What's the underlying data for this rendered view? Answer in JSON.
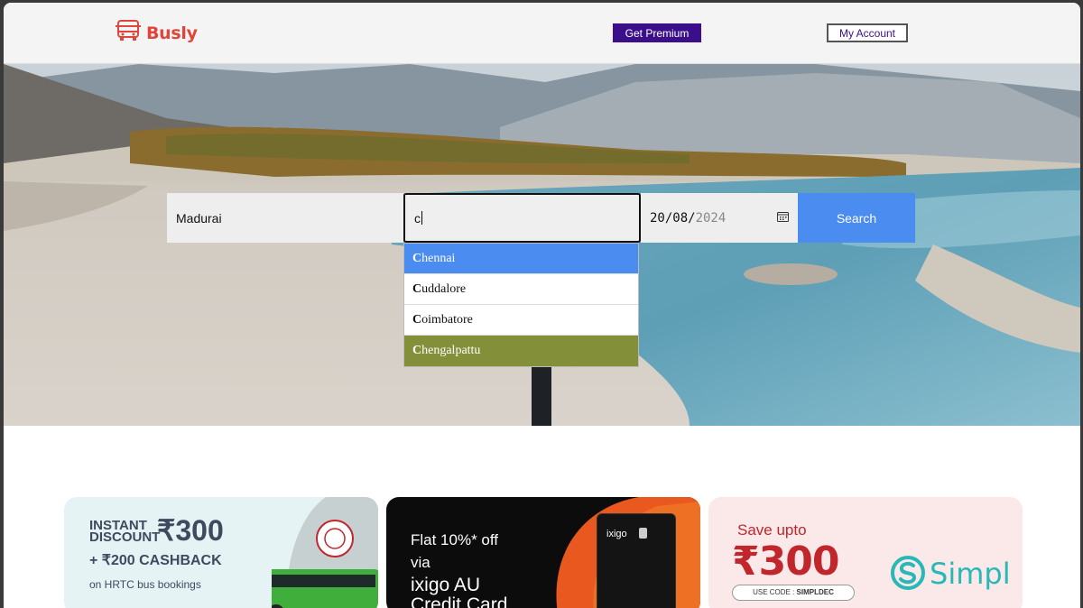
{
  "header": {
    "brand": "Busly",
    "premium_label": "Get Premium",
    "account_label": "My Account"
  },
  "search": {
    "from_value": "Madurai",
    "to_value": "c",
    "date_day_month": "20/08/",
    "date_year": "2024",
    "search_label": "Search"
  },
  "suggestions": [
    {
      "match": "C",
      "rest": "hennai"
    },
    {
      "match": "C",
      "rest": "uddalore"
    },
    {
      "match": "C",
      "rest": "oimbatore"
    },
    {
      "match": "C",
      "rest": "hengalpattu"
    }
  ],
  "offers": {
    "card1": {
      "title_line1": "INSTANT",
      "title_line2": "DISCOUNT",
      "amount": "₹300",
      "cashback": "+ ₹200 CASHBACK",
      "subtitle": "on HRTC bus bookings"
    },
    "card2": {
      "line1": "Flat 10%* off",
      "line2": "via",
      "line3": "ixigo AU",
      "line4": "Credit Card",
      "card_brand": "ixigo"
    },
    "card3": {
      "save": "Save upto",
      "amount": "₹300",
      "code_prefix": "USE CODE : ",
      "code": "SIMPLDEC",
      "brand": "Simpl"
    }
  },
  "colors": {
    "brand_red": "#e0453b",
    "premium_purple": "#3b0f8a",
    "search_blue": "#4a8cf0",
    "hover_olive": "#848f3a"
  }
}
